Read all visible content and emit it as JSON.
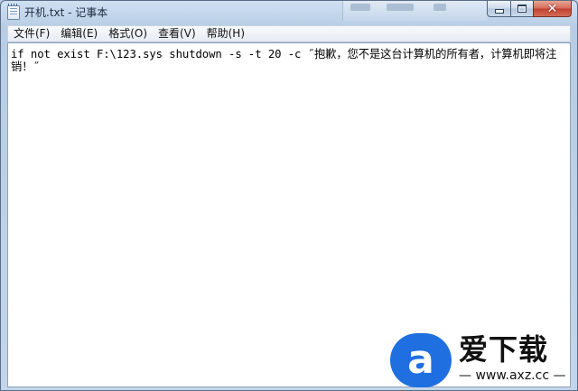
{
  "window": {
    "title": "开机.txt - 记事本"
  },
  "menubar": {
    "items": [
      {
        "label": "文件(F)"
      },
      {
        "label": "编辑(E)"
      },
      {
        "label": "格式(O)"
      },
      {
        "label": "查看(V)"
      },
      {
        "label": "帮助(H)"
      }
    ]
  },
  "editor": {
    "content": "if not exist F:\\123.sys shutdown -s -t 20 -c ˝抱歉，您不是这台计算机的所有者，计算机即将注销！˝"
  },
  "watermark": {
    "brand_cn": "爱下载",
    "url": "— www.axz.cc —",
    "logo_letter": "a"
  }
}
